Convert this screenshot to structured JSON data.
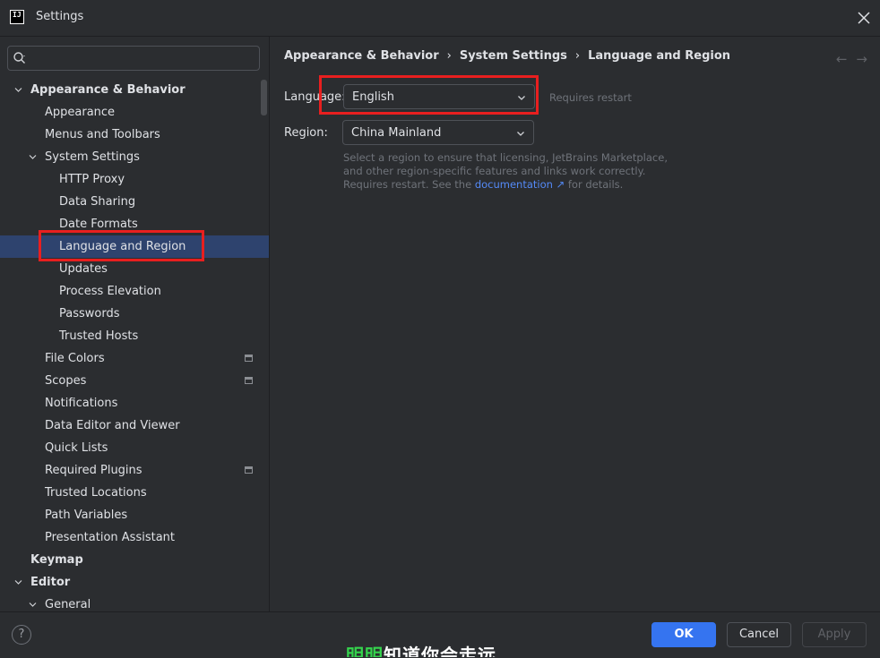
{
  "window": {
    "title": "Settings",
    "app_icon_text": "IJ"
  },
  "search": {
    "placeholder": ""
  },
  "tree": {
    "items": [
      {
        "label": "Appearance & Behavior",
        "level": 0,
        "bold": true,
        "expanded": true
      },
      {
        "label": "Appearance",
        "level": 1
      },
      {
        "label": "Menus and Toolbars",
        "level": 1
      },
      {
        "label": "System Settings",
        "level": 1,
        "expanded": true
      },
      {
        "label": "HTTP Proxy",
        "level": 2
      },
      {
        "label": "Data Sharing",
        "level": 2
      },
      {
        "label": "Date Formats",
        "level": 2
      },
      {
        "label": "Language and Region",
        "level": 2,
        "selected": true
      },
      {
        "label": "Updates",
        "level": 2
      },
      {
        "label": "Process Elevation",
        "level": 2
      },
      {
        "label": "Passwords",
        "level": 2
      },
      {
        "label": "Trusted Hosts",
        "level": 2
      },
      {
        "label": "File Colors",
        "level": 1,
        "badge": true
      },
      {
        "label": "Scopes",
        "level": 1,
        "badge": true
      },
      {
        "label": "Notifications",
        "level": 1
      },
      {
        "label": "Data Editor and Viewer",
        "level": 1
      },
      {
        "label": "Quick Lists",
        "level": 1
      },
      {
        "label": "Required Plugins",
        "level": 1,
        "badge": true
      },
      {
        "label": "Trusted Locations",
        "level": 1
      },
      {
        "label": "Path Variables",
        "level": 1
      },
      {
        "label": "Presentation Assistant",
        "level": 1
      },
      {
        "label": "Keymap",
        "level": 0,
        "bold": true
      },
      {
        "label": "Editor",
        "level": 0,
        "bold": true,
        "expanded": true
      },
      {
        "label": "General",
        "level": 1,
        "expanded": true
      }
    ]
  },
  "breadcrumb": {
    "items": [
      "Appearance & Behavior",
      "System Settings",
      "Language and Region"
    ],
    "separator": "›"
  },
  "nav": {
    "back": "←",
    "forward": "→"
  },
  "form": {
    "language": {
      "label": "Language:",
      "value": "English",
      "hint": "Requires restart"
    },
    "region": {
      "label": "Region:",
      "value": "China Mainland"
    },
    "description": {
      "before": "Select a region to ensure that licensing, JetBrains Marketplace, and other region-specific features and links work correctly. Requires restart. See the",
      "link": "documentation",
      "link_arrow": "↗",
      "after": "for details."
    }
  },
  "footer": {
    "help": "?",
    "ok": "OK",
    "cancel": "Cancel",
    "apply": "Apply"
  },
  "overlay": {
    "green": "明明",
    "white": "知道你会走远"
  },
  "colors": {
    "background": "#2b2d30",
    "selected": "#2e436e",
    "accent": "#3574f0",
    "link": "#548af7",
    "highlight_box": "#e81f1f"
  }
}
